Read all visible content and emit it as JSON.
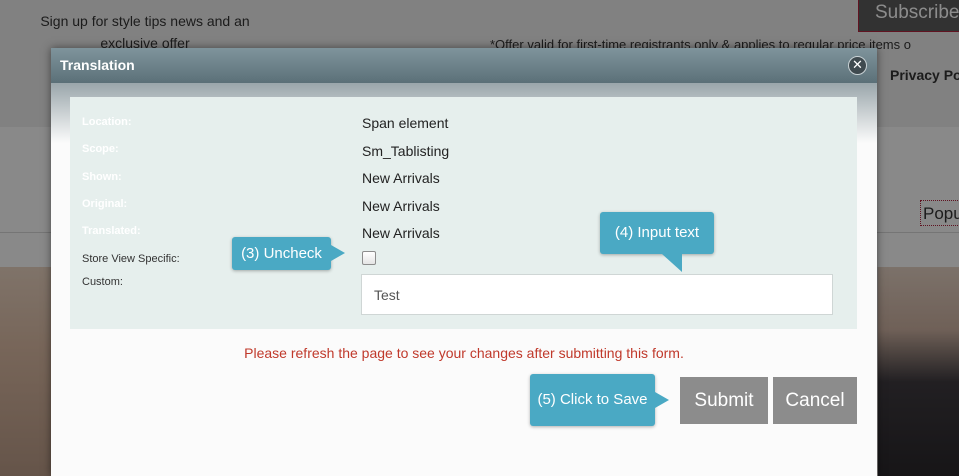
{
  "background": {
    "signup_text": "Sign up for style tips news and an exclusive offer",
    "subscribe_label": "Subscribe",
    "offer_text": "*Offer valid for first-time registrants only & applies to regular price items o",
    "privacy_label": "Privacy Po",
    "popular_label": "Popu"
  },
  "dialog": {
    "title": "Translation",
    "close_icon": "close-icon",
    "fields": {
      "location_label": "Location:",
      "location_value": "Span element",
      "scope_label": "Scope:",
      "scope_value": "Sm_Tablisting",
      "shown_label": "Shown:",
      "shown_value": "New Arrivals",
      "original_label": "Original:",
      "original_value": "New Arrivals",
      "translated_label": "Translated:",
      "translated_value": "New Arrivals",
      "store_view_label": "Store View Specific:",
      "store_view_checked": false,
      "custom_label": "Custom:",
      "custom_value": "Test"
    },
    "notice": "Please refresh the page to see your changes after submitting this form.",
    "submit_label": "Submit",
    "cancel_label": "Cancel"
  },
  "callouts": {
    "uncheck": "(3) Uncheck",
    "input_text": "(4) Input text",
    "save": "(5) Click to Save"
  },
  "colors": {
    "header": "#6a7f87",
    "panel": "#e6efed",
    "callout": "#4aa9c4",
    "button": "#8c8c8c",
    "notice": "#c0392b"
  }
}
